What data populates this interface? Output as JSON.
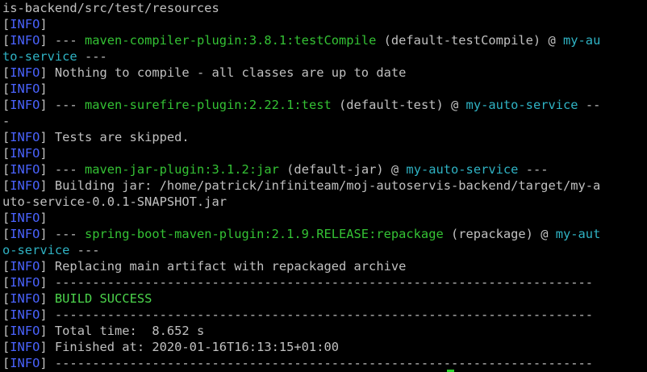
{
  "terminal": {
    "lines": [
      [
        {
          "t": "is-backend/src/test/resources",
          "c": "default"
        }
      ],
      [
        {
          "t": "[",
          "c": "default"
        },
        {
          "t": "INFO",
          "c": "blue"
        },
        {
          "t": "]",
          "c": "default"
        }
      ],
      [
        {
          "t": "[",
          "c": "default"
        },
        {
          "t": "INFO",
          "c": "blue"
        },
        {
          "t": "] --- ",
          "c": "default"
        },
        {
          "t": "maven-compiler-plugin:3.8.1:testCompile",
          "c": "green"
        },
        {
          "t": " (default-testCompile) @ ",
          "c": "default"
        },
        {
          "t": "my-au",
          "c": "cyan"
        }
      ],
      [
        {
          "t": "to-service",
          "c": "cyan"
        },
        {
          "t": " ---",
          "c": "default"
        }
      ],
      [
        {
          "t": "[",
          "c": "default"
        },
        {
          "t": "INFO",
          "c": "blue"
        },
        {
          "t": "] Nothing to compile - all classes are up to date",
          "c": "default"
        }
      ],
      [
        {
          "t": "[",
          "c": "default"
        },
        {
          "t": "INFO",
          "c": "blue"
        },
        {
          "t": "]",
          "c": "default"
        }
      ],
      [
        {
          "t": "[",
          "c": "default"
        },
        {
          "t": "INFO",
          "c": "blue"
        },
        {
          "t": "] --- ",
          "c": "default"
        },
        {
          "t": "maven-surefire-plugin:2.22.1:test",
          "c": "green"
        },
        {
          "t": " (default-test) @ ",
          "c": "default"
        },
        {
          "t": "my-auto-service",
          "c": "cyan"
        },
        {
          "t": " --",
          "c": "default"
        }
      ],
      [
        {
          "t": "-",
          "c": "default"
        }
      ],
      [
        {
          "t": "[",
          "c": "default"
        },
        {
          "t": "INFO",
          "c": "blue"
        },
        {
          "t": "] Tests are skipped.",
          "c": "default"
        }
      ],
      [
        {
          "t": "[",
          "c": "default"
        },
        {
          "t": "INFO",
          "c": "blue"
        },
        {
          "t": "]",
          "c": "default"
        }
      ],
      [
        {
          "t": "[",
          "c": "default"
        },
        {
          "t": "INFO",
          "c": "blue"
        },
        {
          "t": "] --- ",
          "c": "default"
        },
        {
          "t": "maven-jar-plugin:3.1.2:jar",
          "c": "green"
        },
        {
          "t": " (default-jar) @ ",
          "c": "default"
        },
        {
          "t": "my-auto-service",
          "c": "cyan"
        },
        {
          "t": " ---",
          "c": "default"
        }
      ],
      [
        {
          "t": "[",
          "c": "default"
        },
        {
          "t": "INFO",
          "c": "blue"
        },
        {
          "t": "] Building jar: /home/patrick/infiniteam/moj-autoservis-backend/target/my-a",
          "c": "default"
        }
      ],
      [
        {
          "t": "uto-service-0.0.1-SNAPSHOT.jar",
          "c": "default"
        }
      ],
      [
        {
          "t": "[",
          "c": "default"
        },
        {
          "t": "INFO",
          "c": "blue"
        },
        {
          "t": "]",
          "c": "default"
        }
      ],
      [
        {
          "t": "[",
          "c": "default"
        },
        {
          "t": "INFO",
          "c": "blue"
        },
        {
          "t": "] --- ",
          "c": "default"
        },
        {
          "t": "spring-boot-maven-plugin:2.1.9.RELEASE:repackage",
          "c": "green"
        },
        {
          "t": " (repackage) @ ",
          "c": "default"
        },
        {
          "t": "my-aut",
          "c": "cyan"
        }
      ],
      [
        {
          "t": "o-service",
          "c": "cyan"
        },
        {
          "t": " ---",
          "c": "default"
        }
      ],
      [
        {
          "t": "[",
          "c": "default"
        },
        {
          "t": "INFO",
          "c": "blue"
        },
        {
          "t": "] Replacing main artifact with repackaged archive",
          "c": "default"
        }
      ],
      [
        {
          "t": "[",
          "c": "default"
        },
        {
          "t": "INFO",
          "c": "blue"
        },
        {
          "t": "] ------------------------------------------------------------------------",
          "c": "default"
        }
      ],
      [
        {
          "t": "[",
          "c": "default"
        },
        {
          "t": "INFO",
          "c": "blue"
        },
        {
          "t": "] ",
          "c": "default"
        },
        {
          "t": "BUILD SUCCESS",
          "c": "brightgreen"
        }
      ],
      [
        {
          "t": "[",
          "c": "default"
        },
        {
          "t": "INFO",
          "c": "blue"
        },
        {
          "t": "] ------------------------------------------------------------------------",
          "c": "default"
        }
      ],
      [
        {
          "t": "[",
          "c": "default"
        },
        {
          "t": "INFO",
          "c": "blue"
        },
        {
          "t": "] Total time:  8.652 s",
          "c": "default"
        }
      ],
      [
        {
          "t": "[",
          "c": "default"
        },
        {
          "t": "INFO",
          "c": "blue"
        },
        {
          "t": "] Finished at: 2020-01-16T16:13:15+01:00",
          "c": "default"
        }
      ],
      [
        {
          "t": "[",
          "c": "default"
        },
        {
          "t": "INFO",
          "c": "blue"
        },
        {
          "t": "] ------------------------------------------------------------------------",
          "c": "default"
        }
      ]
    ]
  },
  "colors": {
    "background": "#000000",
    "default": "#c0c0c0",
    "blue": "#4a63ff",
    "green": "#34c234",
    "cyan": "#2fb3c4",
    "brightgreen": "#4cd54c",
    "cursor": "#2bd12b"
  }
}
